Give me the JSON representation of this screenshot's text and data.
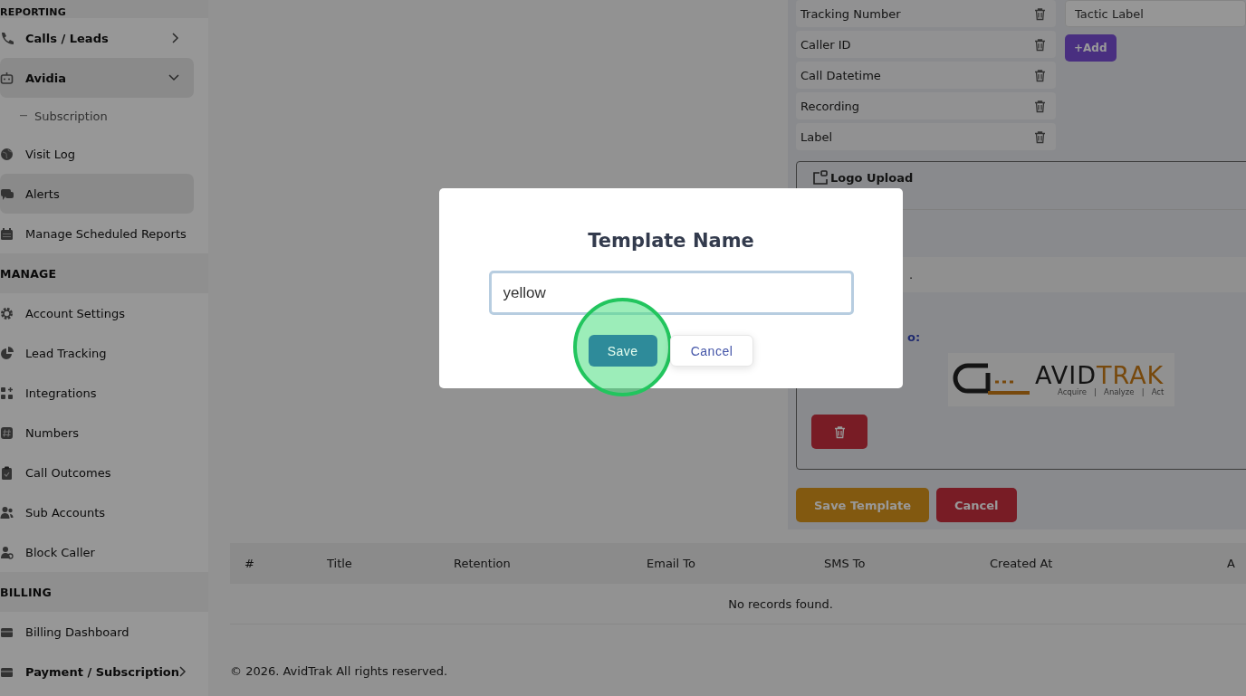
{
  "sidebar": {
    "sections": [
      {
        "title": "REPORTING",
        "items": [
          {
            "label": "Calls / Leads",
            "kind": "group",
            "expanded": false,
            "selected": false
          },
          {
            "label": "Avidia",
            "kind": "group",
            "expanded": true,
            "selected": true,
            "children": [
              {
                "label": "Subscription",
                "selected": false
              }
            ]
          },
          {
            "label": "Visit Log",
            "kind": "link",
            "selected": false
          },
          {
            "label": "Alerts",
            "kind": "link",
            "selected": true
          },
          {
            "label": "Manage Scheduled Reports",
            "kind": "link",
            "selected": false
          }
        ]
      },
      {
        "title": "MANAGE",
        "items": [
          {
            "label": "Account Settings",
            "kind": "link",
            "selected": false
          },
          {
            "label": "Lead Tracking",
            "kind": "link",
            "selected": false
          },
          {
            "label": "Integrations",
            "kind": "link",
            "selected": false
          },
          {
            "label": "Numbers",
            "kind": "link",
            "selected": false
          },
          {
            "label": "Call Outcomes",
            "kind": "link",
            "selected": false
          },
          {
            "label": "Sub Accounts",
            "kind": "link",
            "selected": false
          },
          {
            "label": "Block Caller",
            "kind": "link",
            "selected": false
          }
        ]
      },
      {
        "title": "BILLING",
        "items": [
          {
            "label": "Billing Dashboard",
            "kind": "link",
            "selected": false
          },
          {
            "label": "Payment / Subscription",
            "kind": "group",
            "expanded": false,
            "selected": false
          }
        ]
      }
    ]
  },
  "fields": [
    "Tracking Number",
    "Caller ID",
    "Call Datetime",
    "Recording",
    "Label"
  ],
  "tactic_field": {
    "value": "Tactic Label"
  },
  "add_button": "+Add",
  "logo_card": {
    "title": "Logo Upload",
    "file_note": ".",
    "current_label": "o:",
    "logo": {
      "brand_dark": "AVID",
      "brand_accent": "TRAK",
      "tagline": "Acquire   |   Analyze   |   Act"
    }
  },
  "actions": [
    {
      "label": "Save Template",
      "kind": "primary"
    },
    {
      "label": "Cancel",
      "kind": "danger"
    }
  ],
  "table": {
    "columns": [
      "#",
      "Title",
      "Retention",
      "Email To",
      "SMS To",
      "Created At",
      "A"
    ],
    "empty": "No records found."
  },
  "footer": "© 2026. AvidTrak All rights reserved.",
  "modal": {
    "title": "Template Name",
    "input": {
      "value": "yellow"
    },
    "buttons": [
      {
        "label": "Save",
        "kind": "primary",
        "highlighted": true
      },
      {
        "label": "Cancel",
        "kind": "secondary",
        "highlighted": false
      }
    ]
  }
}
